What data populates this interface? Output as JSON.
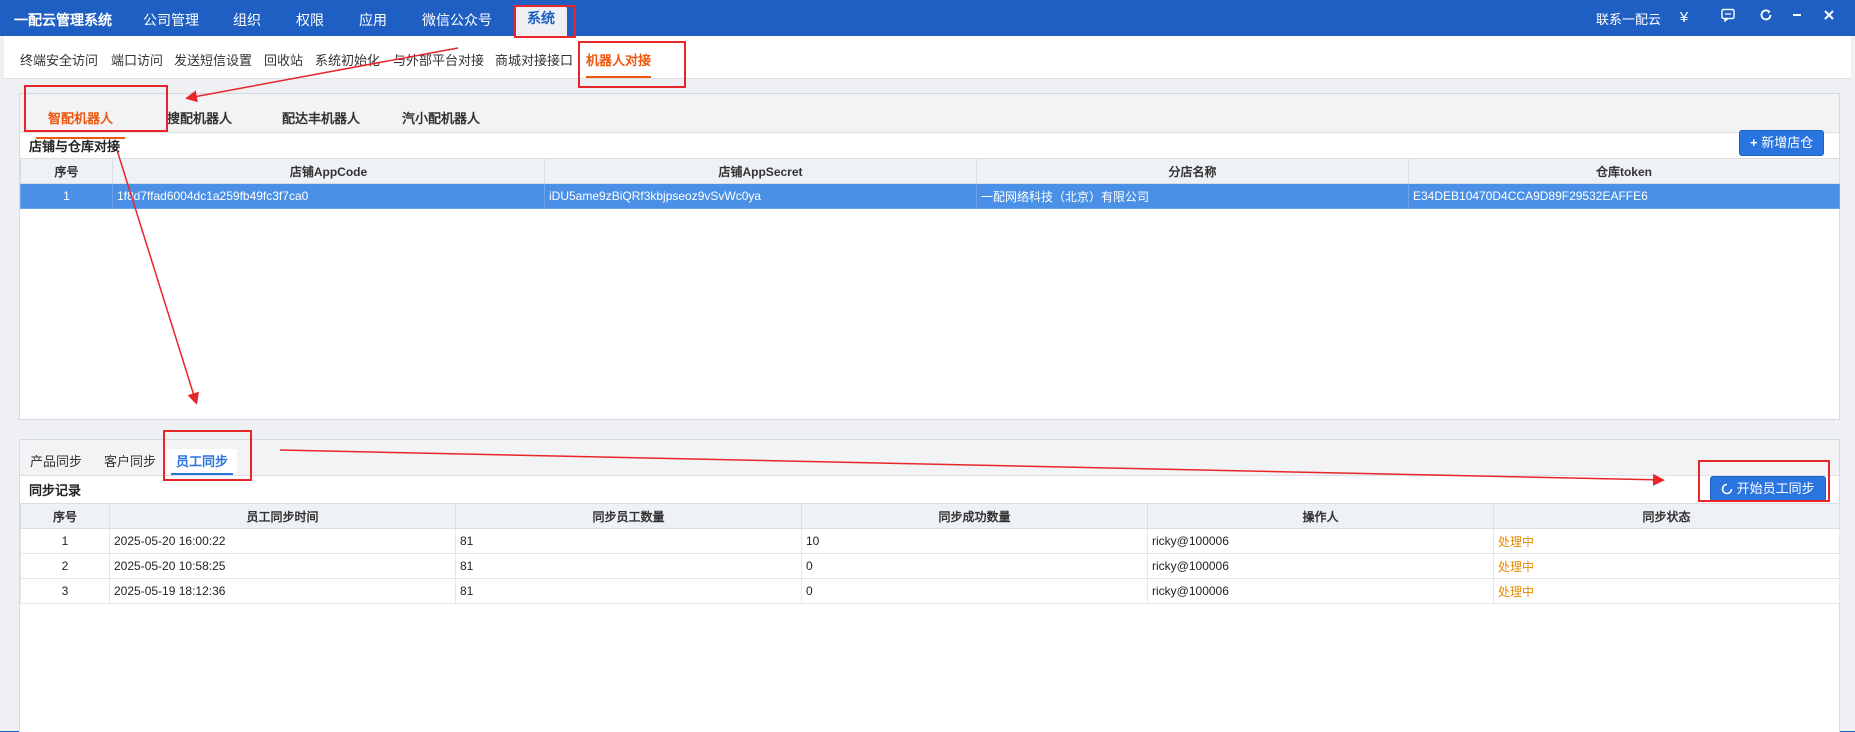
{
  "topnav": {
    "brand": "一配云管理系统",
    "items": [
      "公司管理",
      "组织",
      "权限",
      "应用",
      "微信公众号",
      "系统"
    ],
    "active": "系统",
    "contact": "联系一配云",
    "currency_icon": "¥",
    "icons": [
      "chat-icon",
      "refresh-icon",
      "minimize-icon",
      "close-icon"
    ]
  },
  "subnav": {
    "items": [
      "终端安全访问",
      "端口访问",
      "发送短信设置",
      "回收站",
      "系统初始化",
      "与外部平台对接",
      "商城对接接口",
      "机器人对接"
    ],
    "active": "机器人对接"
  },
  "robot_tabs": {
    "items": [
      "智配机器人",
      "搜配机器人",
      "配达丰机器人",
      "汽小配机器人"
    ],
    "active": "智配机器人"
  },
  "store_section": {
    "title": "店铺与仓库对接",
    "add_button": "新增店仓",
    "columns": [
      "序号",
      "店铺AppCode",
      "店铺AppSecret",
      "分店名称",
      "仓库token"
    ],
    "rows": [
      [
        "1",
        "1f8d7ffad6004dc1a259fb49fc3f7ca0",
        "iDU5ame9zBiQRf3kbjpseoz9vSvWc0ya",
        "一配网络科技（北京）有限公司",
        "E34DEB10470D4CCA9D89F29532EAFFE6"
      ]
    ]
  },
  "sync_tabs": {
    "items": [
      "产品同步",
      "客户同步",
      "员工同步"
    ],
    "active": "员工同步"
  },
  "sync_section": {
    "title": "同步记录",
    "start_button": "开始员工同步",
    "columns": [
      "序号",
      "员工同步时间",
      "同步员工数量",
      "同步成功数量",
      "操作人",
      "同步状态"
    ],
    "rows": [
      [
        "1",
        "2025-05-20 16:00:22",
        "81",
        "10",
        "ricky@100006",
        "处理中"
      ],
      [
        "2",
        "2025-05-20 10:58:25",
        "81",
        "0",
        "ricky@100006",
        "处理中"
      ],
      [
        "3",
        "2025-05-19 18:12:36",
        "81",
        "0",
        "ricky@100006",
        "处理中"
      ]
    ]
  },
  "colors": {
    "nav_blue": "#1f5fc4",
    "accent_orange": "#f0560e",
    "selected_row": "#4a90e6",
    "status_orange": "#e68a00",
    "annotation_red": "#e8262a"
  }
}
